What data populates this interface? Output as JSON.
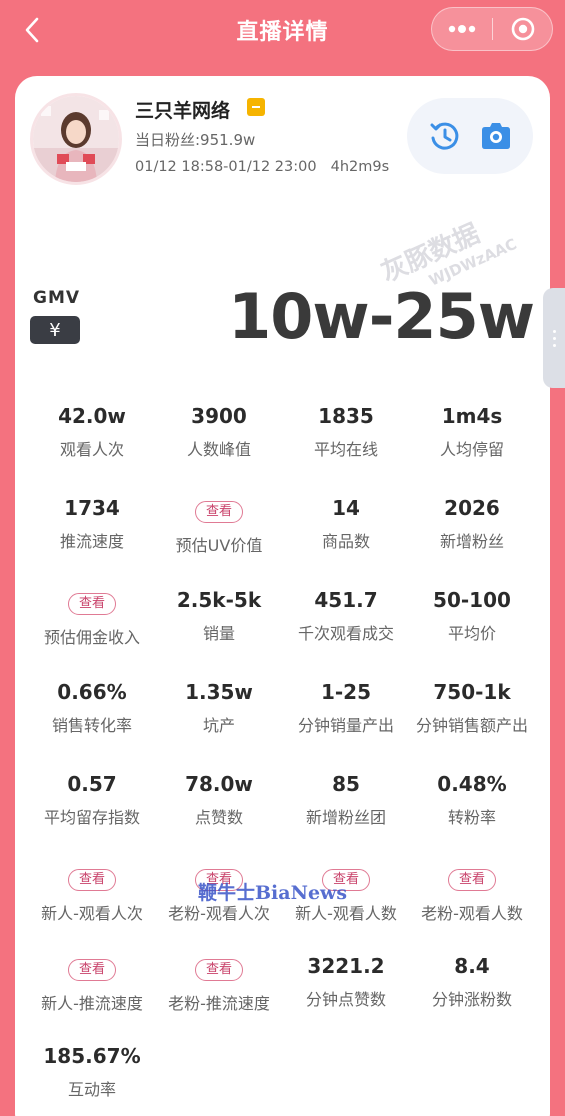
{
  "header": {
    "title": "直播详情"
  },
  "anchor": {
    "name": "三只羊网络",
    "fans": "当日粉丝:951.9w",
    "time_range": "01/12 18:58-01/12 23:00",
    "duration": "4h2m9s"
  },
  "watermark": {
    "brand": "灰豚数据",
    "code": "WJDWzAAC"
  },
  "gmv": {
    "label": "GMV",
    "currency": "¥",
    "value": "10w-25w"
  },
  "metrics": [
    {
      "value": "42.0w",
      "label": "观看人次"
    },
    {
      "value": "3900",
      "label": "人数峰值"
    },
    {
      "value": "1835",
      "label": "平均在线"
    },
    {
      "value": "1m4s",
      "label": "人均停留"
    },
    {
      "value": "1734",
      "label": "推流速度"
    },
    {
      "button": "查看",
      "label": "预估UV价值"
    },
    {
      "value": "14",
      "label": "商品数"
    },
    {
      "value": "2026",
      "label": "新增粉丝"
    },
    {
      "button": "查看",
      "label": "预估佣金收入"
    },
    {
      "value": "2.5k-5k",
      "label": "销量"
    },
    {
      "value": "451.7",
      "label": "千次观看成交"
    },
    {
      "value": "50-100",
      "label": "平均价"
    },
    {
      "value": "0.66%",
      "label": "销售转化率"
    },
    {
      "value": "1.35w",
      "label": "坑产"
    },
    {
      "value": "1-25",
      "label": "分钟销量产出"
    },
    {
      "value": "750-1k",
      "label": "分钟销售额产出"
    },
    {
      "value": "0.57",
      "label": "平均留存指数"
    },
    {
      "value": "78.0w",
      "label": "点赞数"
    },
    {
      "value": "85",
      "label": "新增粉丝团"
    },
    {
      "value": "0.48%",
      "label": "转粉率"
    },
    {
      "button": "查看",
      "label": "新人-观看人次"
    },
    {
      "button": "查看",
      "label": "老粉-观看人次"
    },
    {
      "button": "查看",
      "label": "新人-观看人数"
    },
    {
      "button": "查看",
      "label": "老粉-观看人数"
    },
    {
      "button": "查看",
      "label": "新人-推流速度"
    },
    {
      "button": "查看",
      "label": "老粉-推流速度"
    },
    {
      "value": "3221.2",
      "label": "分钟点赞数"
    },
    {
      "value": "8.4",
      "label": "分钟涨粉数"
    },
    {
      "value": "185.67%",
      "label": "互动率"
    }
  ],
  "overlay_watermark": "鞭牛士BiaNews",
  "colors": {
    "background": "#f4727f",
    "card": "#ffffff",
    "accent": "#c9436b",
    "icon_blue": "#3b8fe6"
  },
  "icons": [
    "back-icon",
    "more-icon",
    "close-target-icon",
    "history-icon",
    "camera-icon"
  ]
}
